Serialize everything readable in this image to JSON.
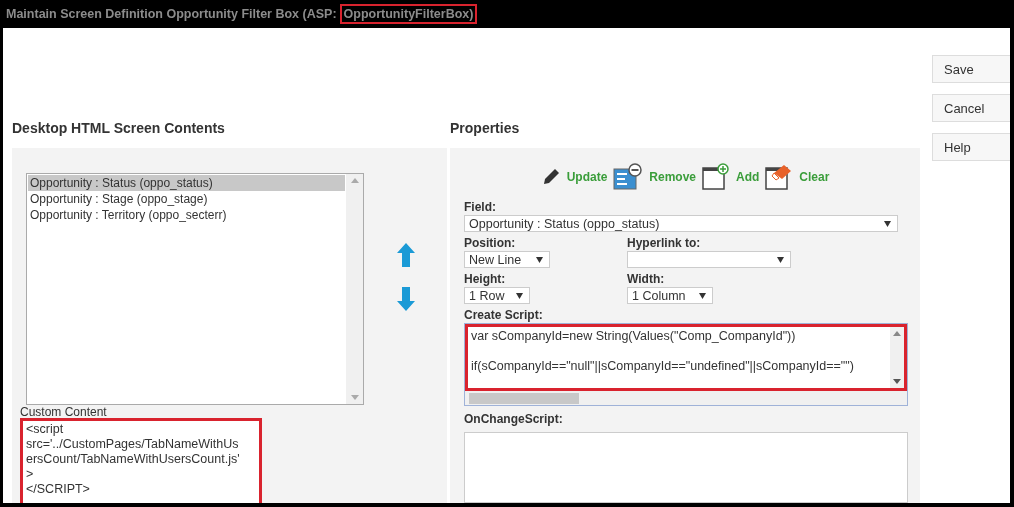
{
  "window": {
    "title_parts": [
      {
        "text": "Maintain Screen Definition Opportunity Filter Box (ASP:",
        "highlighted": false
      },
      {
        "text": "OpportunityFilterBox)",
        "highlighted": true
      }
    ]
  },
  "screen_contents": {
    "heading": "Desktop HTML Screen Contents",
    "list_items": [
      {
        "label": "Opportunity : Status (oppo_status)",
        "selected": true
      },
      {
        "label": "Opportunity : Stage (oppo_stage)",
        "selected": false
      },
      {
        "label": "Opportunity : Territory (oppo_secterr)",
        "selected": false
      }
    ],
    "custom_content": {
      "label": "Custom Content",
      "highlighted": true,
      "lines": [
        "<script",
        "src='../CustomPages/TabNameWithUs",
        "ersCount/TabNameWithUsersCount.js'",
        ">",
        "</SCRIPT>"
      ]
    }
  },
  "properties": {
    "heading": "Properties",
    "toolbar": [
      {
        "kind": "update",
        "label": "Update"
      },
      {
        "kind": "remove",
        "label": "Remove"
      },
      {
        "kind": "add",
        "label": "Add"
      },
      {
        "kind": "clear",
        "label": "Clear"
      }
    ],
    "field": {
      "label": "Field:",
      "value": "Opportunity : Status (oppo_status)"
    },
    "position": {
      "label": "Position:",
      "value": "New Line"
    },
    "hyperlink": {
      "label": "Hyperlink to:"
    },
    "height": {
      "label": "Height:",
      "value": "1 Row"
    },
    "width": {
      "label": "Width:",
      "value": "1 Column"
    },
    "create_script": {
      "label": "Create Script:",
      "highlighted": true,
      "lines": [
        "var sCompanyId=new String(Values(\"Comp_CompanyId\"))",
        "if(sCompanyId==\"null\"||sCompanyId==\"undefined\"||sCompanyId==\"\")"
      ]
    },
    "on_change_script": {
      "label": "OnChangeScript:"
    }
  },
  "buttons": [
    {
      "label": "Save"
    },
    {
      "label": "Cancel"
    },
    {
      "label": "Help"
    }
  ]
}
